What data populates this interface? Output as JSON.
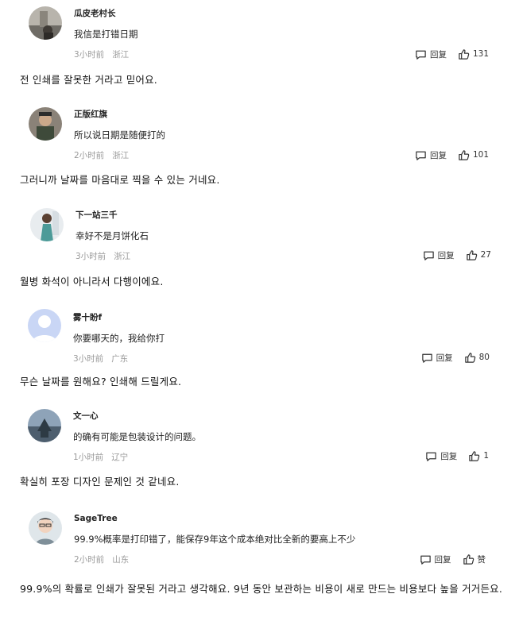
{
  "comments": [
    {
      "username": "瓜皮老村长",
      "text": "我信是打错日期",
      "time": "3小时前",
      "location": "浙江",
      "reply_label": "回复",
      "likes": "131",
      "translation": "전 인쇄를 잘못한 거라고 믿어요."
    },
    {
      "username": "正版红旗",
      "text": "所以说日期是随便打的",
      "time": "2小时前",
      "location": "浙江",
      "reply_label": "回复",
      "likes": "101",
      "translation": "그러니까 날짜를 마음대로 찍을 수 있는 거네요."
    },
    {
      "username": "下一站三千",
      "text": "幸好不是月饼化石",
      "time": "3小时前",
      "location": "浙江",
      "reply_label": "回复",
      "likes": "27",
      "translation": "월병 화석이 아니라서 다행이에요."
    },
    {
      "username": "雾十盼f",
      "text": "你要哪天的，我给你打",
      "time": "3小时前",
      "location": "广东",
      "reply_label": "回复",
      "likes": "80",
      "translation": "무슨 날짜를 원해요? 인쇄해 드릴게요."
    },
    {
      "username": "文一心",
      "text": "的确有可能是包装设计的问题。",
      "time": "1小时前",
      "location": "辽宁",
      "reply_label": "回复",
      "likes": "1",
      "translation": "확실히 포장 디자인 문제인 것 같네요."
    },
    {
      "username": "SageTree",
      "text": "99.9%概率是打印错了，能保存9年这个成本绝对比全新的要高上不少",
      "time": "2小时前",
      "location": "山东",
      "reply_label": "回复",
      "likes": "赞",
      "translation": "99.9%의 확률로 인쇄가 잘못된 거라고 생각해요. 9년 동안 보관하는 비용이 새로 만드는 비용보다 높을 거거든요."
    }
  ],
  "colors": {
    "meta": "#9a9a9a",
    "text": "#222222",
    "avatar_default": "#c9d6f5"
  },
  "icons": {
    "reply": "comment-bubble-icon",
    "like": "thumbs-up-icon"
  }
}
